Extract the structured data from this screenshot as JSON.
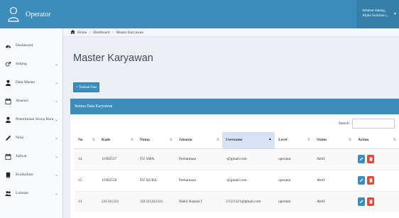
{
  "header": {
    "app_title": "Operator",
    "user_line1": "Selamat datang,",
    "user_line2": "Alpha Solution (..."
  },
  "sidebar": {
    "items": [
      {
        "label": "Dashboard",
        "icon": "dashboard-icon",
        "has_children": false
      },
      {
        "label": "Setting",
        "icon": "gears-icon",
        "has_children": true
      },
      {
        "label": "Data Master",
        "icon": "user-icon",
        "has_children": true
      },
      {
        "label": "Absensi",
        "icon": "calendar-icon",
        "has_children": true
      },
      {
        "label": "Penerimaan Siswa Baru",
        "icon": "user-icon",
        "has_children": true
      },
      {
        "label": "Nilai",
        "icon": "pencil-icon",
        "has_children": true
      },
      {
        "label": "Jadwal",
        "icon": "calendar-icon",
        "has_children": true
      },
      {
        "label": "Kurikulum",
        "icon": "book-icon",
        "has_children": true
      },
      {
        "label": "Lulusan",
        "icon": "users-icon",
        "has_children": true
      }
    ]
  },
  "breadcrumb": {
    "home": "Home",
    "dashboard": "Dashboard",
    "current": "Master Karyawan"
  },
  "page": {
    "title": "Master Karyawan",
    "add_button": "Tambah Data",
    "panel_title": "Semua Data Karyawan",
    "search_label": "Search:"
  },
  "table": {
    "columns": [
      "No",
      "Kode",
      "Nama",
      "Jabatan",
      "Username",
      "Level",
      "Status",
      "Action"
    ],
    "active_sort_column": "Username",
    "rows": [
      {
        "no": "14",
        "kode": "11902557",
        "nama": "TU SMA",
        "jabatan": "Perbantuan",
        "username": "-@gmail.com",
        "level": "operator",
        "status": "Aktif"
      },
      {
        "no": "15",
        "kode": "11902558",
        "nama": "TU QUBA",
        "jabatan": "Perbantuan",
        "username": "-@gmail.com",
        "level": "operator",
        "status": "Aktif"
      },
      {
        "no": "13",
        "kode": "231321321",
        "nama": "321321321321",
        "jabatan": "Wakil Kepala I",
        "username": "21321321@gmail.com",
        "level": "operator",
        "status": "Aktif"
      }
    ]
  },
  "colors": {
    "primary": "#3c8dbc",
    "danger": "#dd4b39",
    "sidebar_bg": "#f9fafc"
  }
}
